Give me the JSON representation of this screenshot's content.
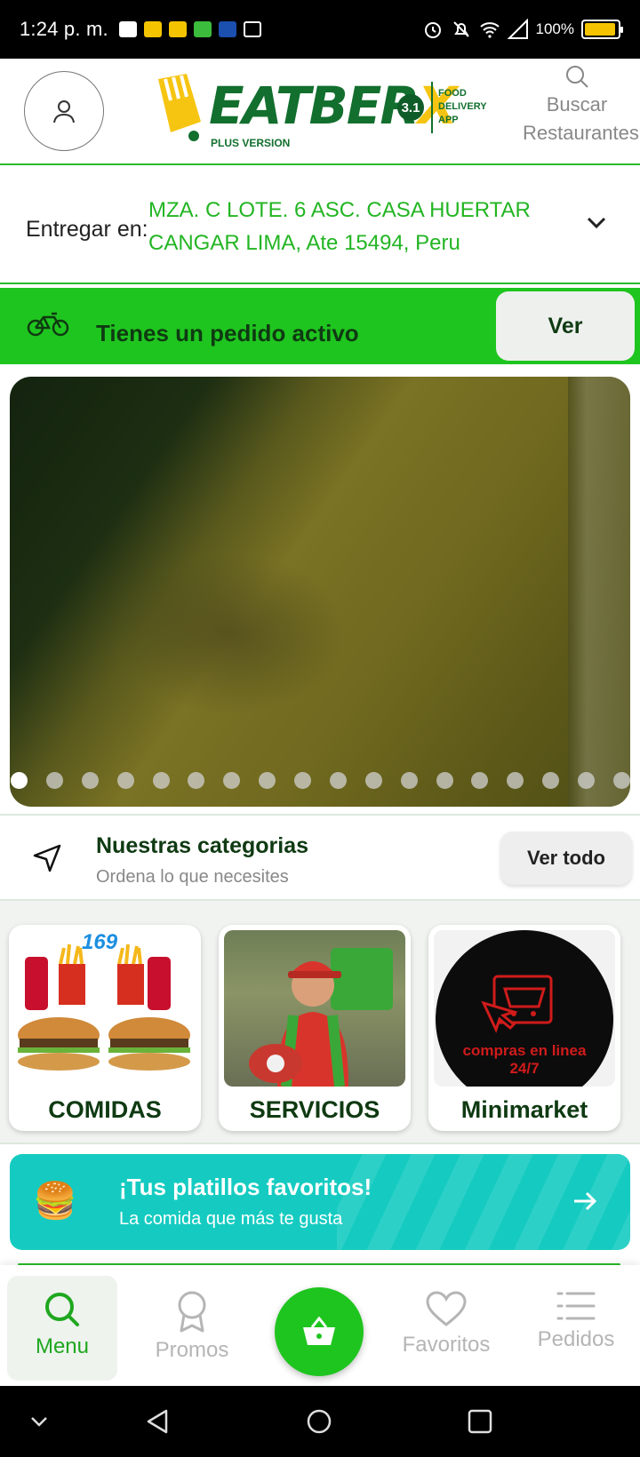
{
  "status_bar": {
    "time": "1:24 p. m.",
    "battery": "100%"
  },
  "header": {
    "logo": {
      "brand": "EATBER",
      "brand_x": "X",
      "version": "3.1",
      "tagline": "PLUS VERSION",
      "side_text": "FOOD DELIVERY APP"
    },
    "search_label_line1": "Buscar",
    "search_label_line2": "Restaurantes",
    "avatar_icon": "user-icon"
  },
  "delivery": {
    "label": "Entregar en:",
    "address": "MZA. C LOTE. 6 ASC. CASA HUERTAR CANGAR LIMA, Ate 15494, Peru"
  },
  "active_order": {
    "text": "Tienes un pedido activo",
    "button": "Ver",
    "icon": "bicycle-icon"
  },
  "carousel": {
    "slide_count": 18,
    "active_index": 0
  },
  "categories": {
    "title": "Nuestras categorias",
    "subtitle": "Ordena lo que necesites",
    "see_all": "Ver todo",
    "items": [
      {
        "label": "COMIDAS",
        "price_badge": "169"
      },
      {
        "label": "SERVICIOS"
      },
      {
        "label": "Minimarket",
        "image_text": "compras en linea 24/7"
      }
    ]
  },
  "favorites_banner": {
    "title": "¡Tus platillos favoritos!",
    "subtitle": "La comida que más te gusta",
    "icon": "burger-icon"
  },
  "bottom_nav": {
    "items": [
      {
        "label": "Menu",
        "icon": "search-icon",
        "active": true
      },
      {
        "label": "Promos",
        "icon": "award-icon",
        "active": false
      },
      {
        "label": "Favoritos",
        "icon": "heart-icon",
        "active": false
      },
      {
        "label": "Pedidos",
        "icon": "list-icon",
        "active": false
      }
    ],
    "cart_icon": "basket-icon"
  },
  "colors": {
    "primary_green": "#1fc51f",
    "dark_green": "#0f3a12",
    "address_green": "#23b523",
    "teal": "#15cbc1",
    "logo_yellow": "#f6c512"
  }
}
